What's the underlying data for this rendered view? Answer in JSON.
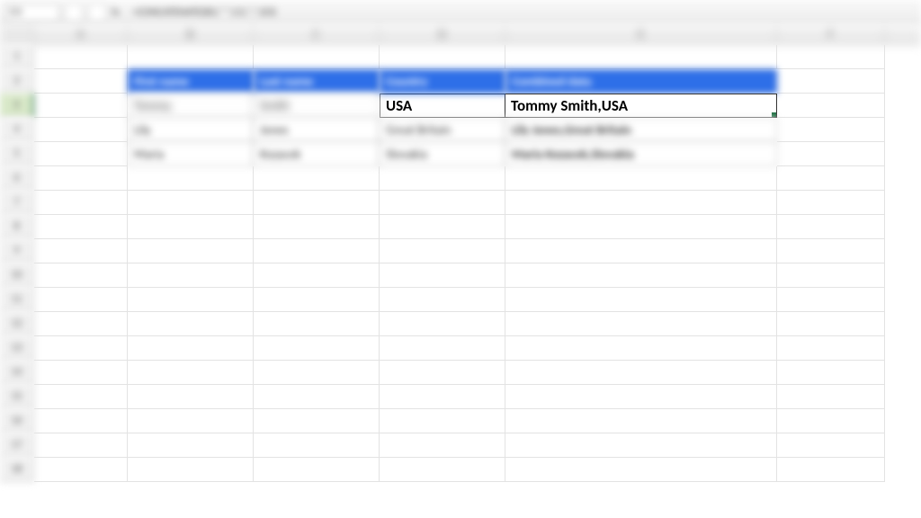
{
  "toolbar": {
    "name_box": "D3",
    "fx_label": "fx",
    "formula": "=CONCATENATE(B3,\" \",C3,\",\",D3)"
  },
  "columns": [
    "A",
    "B",
    "C",
    "D",
    "E",
    "F"
  ],
  "row_numbers": [
    "1",
    "2",
    "3",
    "4",
    "5",
    "6",
    "7",
    "8",
    "9",
    "10",
    "11",
    "12",
    "13",
    "14",
    "15",
    "16",
    "17",
    "18"
  ],
  "table": {
    "headers": {
      "first_name": "First name",
      "last_name": "Last name",
      "country": "Country",
      "combined": "Combined data"
    },
    "rows": [
      {
        "first_name": "Tommy",
        "last_name": "Smith",
        "country": "USA",
        "combined": "Tommy Smith,USA"
      },
      {
        "first_name": "Lily",
        "last_name": "Jones",
        "country": "Great Britain",
        "combined": "Lily Jones,Great Britain"
      },
      {
        "first_name": "Maria",
        "last_name": "Kozacek",
        "country": "Slovakia",
        "combined": "Maria Kozacek,Slovakia"
      }
    ]
  },
  "active_row": "3"
}
